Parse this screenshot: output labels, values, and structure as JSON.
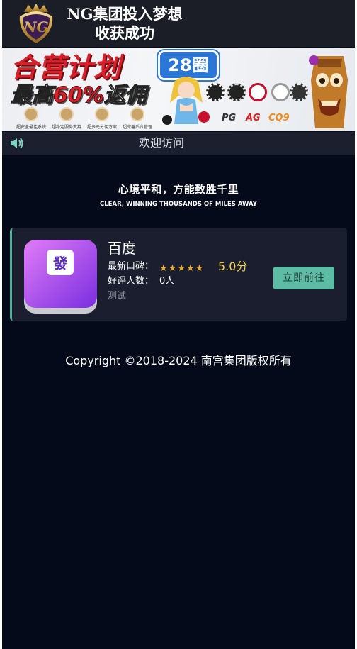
{
  "header": {
    "logo_text": "NG",
    "title_line1": "NG集团投入梦想",
    "title_line2": "收获成功"
  },
  "banner": {
    "title": "合营计划",
    "subtitle_prefix": "最高",
    "subtitle_highlight": "60%",
    "subtitle_suffix": "返佣",
    "badge": "28圈",
    "brands": [
      "PG",
      "AG",
      "CQ9"
    ],
    "features": [
      "超安全最佳系统",
      "超稳定服务支持",
      "超多元分佣方案",
      "超完善后台管理"
    ]
  },
  "welcome": {
    "icon": "speaker-icon",
    "text": "欢迎访问"
  },
  "slogan": {
    "cn": "心境平和，方能致胜千里",
    "en": "CLEAR, WINNING THOUSANDS OF MILES AWAY"
  },
  "card": {
    "name": "百度",
    "icon_char": "發",
    "reputation_label": "最新口碑：",
    "rating_stars": 5,
    "score": "5.0分",
    "fans_label": "好评人数：",
    "fans_value": "0人",
    "tag": "测试",
    "button_label": "立即前往",
    "accent_color": "#4db39c"
  },
  "footer": {
    "copyright": "Copyright ©2018-2024 南宫集团版权所有"
  }
}
